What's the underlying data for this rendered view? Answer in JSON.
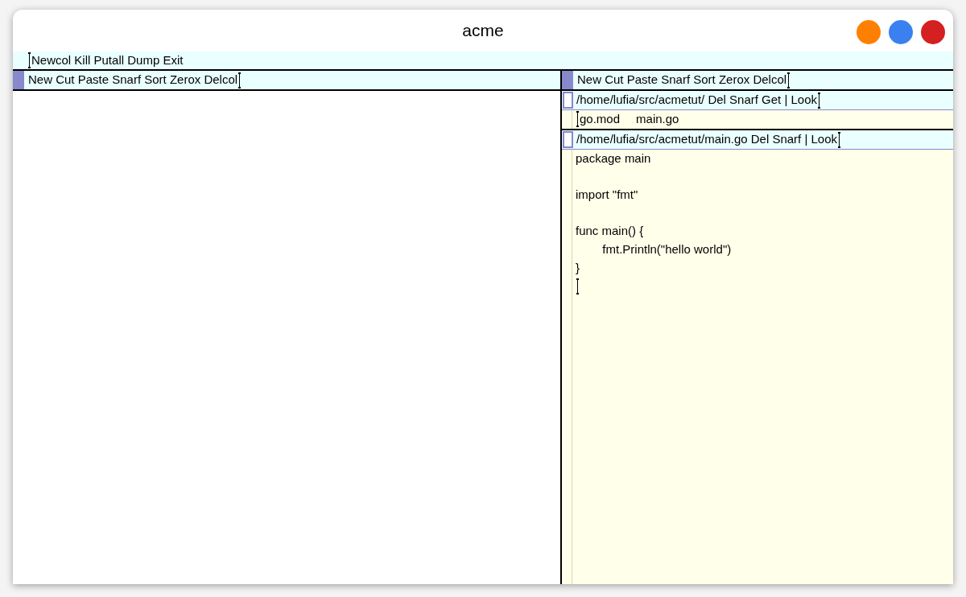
{
  "window": {
    "title": "acme",
    "buttons": [
      {
        "color": "#ff8000"
      },
      {
        "color": "#3a80f0"
      },
      {
        "color": "#d42020"
      }
    ]
  },
  "main_tag": {
    "text": "Newcol Kill Putall Dump Exit",
    "cursor_at_end": false
  },
  "columns": [
    {
      "tag": {
        "text": "New Cut Paste Snarf Sort Zerox Delcol",
        "cursor_at_end": true
      }
    },
    {
      "tag": {
        "text": "New Cut Paste Snarf Sort Zerox Delcol",
        "cursor_at_end": true
      },
      "windows": [
        {
          "tag": {
            "text": "/home/lufia/src/acmetut/ Del Snarf Get | Look",
            "cursor_at_end": true
          },
          "filled": false,
          "body": {
            "kind": "directory",
            "entries": [
              "go.mod",
              "main.go"
            ],
            "cursor_at_end": false
          }
        },
        {
          "tag": {
            "text": "/home/lufia/src/acmetut/main.go Del Snarf | Look",
            "cursor_at_end": true
          },
          "filled": false,
          "body": {
            "kind": "text",
            "text": "package main\n\nimport \"fmt\"\n\nfunc main() {\n\tfmt.Println(\"hello world\")\n}\n",
            "cursor_at_end": true
          }
        }
      ]
    }
  ]
}
